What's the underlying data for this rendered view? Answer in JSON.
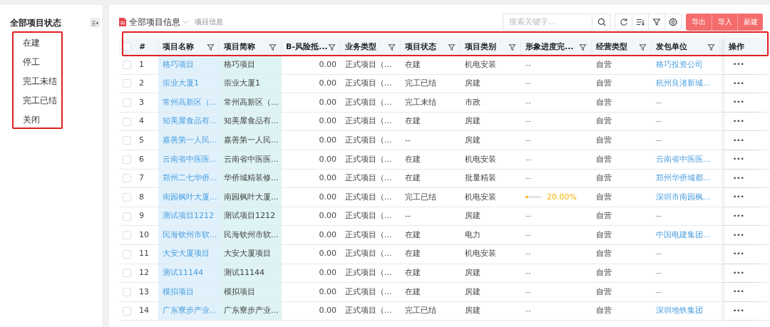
{
  "sidebar": {
    "title": "全部项目状态",
    "items": [
      {
        "label": "在建"
      },
      {
        "label": "停工"
      },
      {
        "label": "完工未结"
      },
      {
        "label": "完工已结"
      },
      {
        "label": "关闭"
      }
    ]
  },
  "toolbar": {
    "title": "全部项目信息",
    "subtitle": "项目信息",
    "search": {
      "placeholder": "搜索关键字..."
    },
    "buttons": [
      "导出",
      "导入",
      "新建"
    ]
  },
  "table": {
    "header_checked": false,
    "columns": [
      {
        "label": "#",
        "filter": false
      },
      {
        "label": "项目名称",
        "filter": true
      },
      {
        "label": "项目简称",
        "filter": true
      },
      {
        "label": "B-风险抵...",
        "filter": true
      },
      {
        "label": "业务类型",
        "filter": true
      },
      {
        "label": "项目状态",
        "filter": true
      },
      {
        "label": "项目类别",
        "filter": true
      },
      {
        "label": "形象进度完...",
        "filter": true
      },
      {
        "label": "经营类型",
        "filter": true
      },
      {
        "label": "发包单位",
        "filter": true
      },
      {
        "label": "操作",
        "filter": false
      }
    ],
    "rows": [
      {
        "checked": false,
        "no": "1",
        "name": "格巧项目",
        "short": "格巧项目",
        "risk": "0.00",
        "biz": "正式项目（...",
        "status": "在建",
        "category": "机电安装",
        "progress": "--",
        "mode": "自营",
        "client": {
          "text": "格巧投资公司",
          "link": true
        },
        "action": "•••"
      },
      {
        "checked": false,
        "no": "2",
        "name": "崇业大厦1",
        "short": "崇业大厦1",
        "risk": "0.00",
        "biz": "正式项目（...",
        "status": "完工已结",
        "category": "房建",
        "progress": "--",
        "mode": "自营",
        "client": {
          "text": "杭州良渚新城...",
          "link": true
        },
        "action": "•••"
      },
      {
        "checked": false,
        "no": "3",
        "name": "常州高新区（...",
        "short": "常州高新区（...",
        "risk": "0.00",
        "biz": "正式项目（...",
        "status": "完工未结",
        "category": "市政",
        "progress": "--",
        "mode": "自营",
        "client": {
          "text": "--",
          "link": false
        },
        "action": "•••"
      },
      {
        "checked": false,
        "no": "4",
        "name": "知美屋食品有...",
        "short": "知美屋食品有...",
        "risk": "0.00",
        "biz": "正式项目（...",
        "status": "在建",
        "category": "房建",
        "progress": "--",
        "mode": "自营",
        "client": {
          "text": "--",
          "link": false
        },
        "action": "•••"
      },
      {
        "checked": false,
        "no": "5",
        "name": "嘉善第一人民...",
        "short": "嘉善第一人民...",
        "risk": "0.00",
        "biz": "正式项目（...",
        "status": "--",
        "category": "房建",
        "progress": "--",
        "mode": "自营",
        "client": {
          "text": "--",
          "link": false
        },
        "action": "•••"
      },
      {
        "checked": false,
        "no": "6",
        "name": "云南省中医医...",
        "short": "云南省中医医...",
        "risk": "0.00",
        "biz": "正式项目（...",
        "status": "在建",
        "category": "机电安装",
        "progress": "--",
        "mode": "自营",
        "client": {
          "text": "云南省中医医...",
          "link": true
        },
        "action": "•••"
      },
      {
        "checked": false,
        "no": "7",
        "name": "郑州二七华侨...",
        "short": "华侨城精装修...",
        "risk": "0.00",
        "biz": "正式项目（...",
        "status": "在建",
        "category": "批量精装",
        "progress": "--",
        "mode": "自营",
        "client": {
          "text": "郑州华侨城都...",
          "link": true
        },
        "action": "•••"
      },
      {
        "checked": false,
        "no": "8",
        "name": "南园枫叶大厦...",
        "short": "南园枫叶大厦...",
        "risk": "0.00",
        "biz": "正式项目（...",
        "status": "完工已结",
        "category": "机电安装",
        "progress": {
          "level": 0.2,
          "reading": "20.00%"
        },
        "mode": "自营",
        "client": {
          "text": "深圳市南园枫...",
          "link": true
        },
        "action": "•••"
      },
      {
        "checked": false,
        "no": "9",
        "name": "测试项目1212",
        "short": "测试项目1212",
        "risk": "0.00",
        "biz": "正式项目（...",
        "status": "--",
        "category": "房建",
        "progress": "--",
        "mode": "自营",
        "client": {
          "text": "--",
          "link": false
        },
        "action": "•••"
      },
      {
        "checked": false,
        "no": "10",
        "name": "民海钦州市软...",
        "short": "民海钦州市软...",
        "risk": "0.00",
        "biz": "正式项目（...",
        "status": "在建",
        "category": "电力",
        "progress": "--",
        "mode": "自营",
        "client": {
          "text": "中国电建集团...",
          "link": true
        },
        "action": "•••"
      },
      {
        "checked": false,
        "no": "11",
        "name": "大安大厦项目",
        "short": "大安大厦项目",
        "risk": "0.00",
        "biz": "正式项目（...",
        "status": "在建",
        "category": "机电安装",
        "progress": "--",
        "mode": "自营",
        "client": {
          "text": "--",
          "link": false
        },
        "action": "•••"
      },
      {
        "checked": false,
        "no": "12",
        "name": "测试11144",
        "short": "测试11144",
        "risk": "0.00",
        "biz": "正式项目（...",
        "status": "在建",
        "category": "房建",
        "progress": "--",
        "mode": "自营",
        "client": {
          "text": "--",
          "link": false
        },
        "action": "•••"
      },
      {
        "checked": false,
        "no": "13",
        "name": "模拟项目",
        "short": "模拟项目",
        "risk": "0.00",
        "biz": "正式项目（...",
        "status": "在建",
        "category": "房建",
        "progress": "--",
        "mode": "自营",
        "client": {
          "text": "--",
          "link": false
        },
        "action": "•••"
      },
      {
        "checked": false,
        "no": "14",
        "name": "广东寮步产业...",
        "short": "广东寮步产业...",
        "risk": "0.00",
        "biz": "正式项目（...",
        "status": "完工已结",
        "category": "房建",
        "progress": "--",
        "mode": "自营",
        "client": {
          "text": "深圳地铁集团",
          "link": true
        },
        "action": "•••"
      }
    ]
  }
}
